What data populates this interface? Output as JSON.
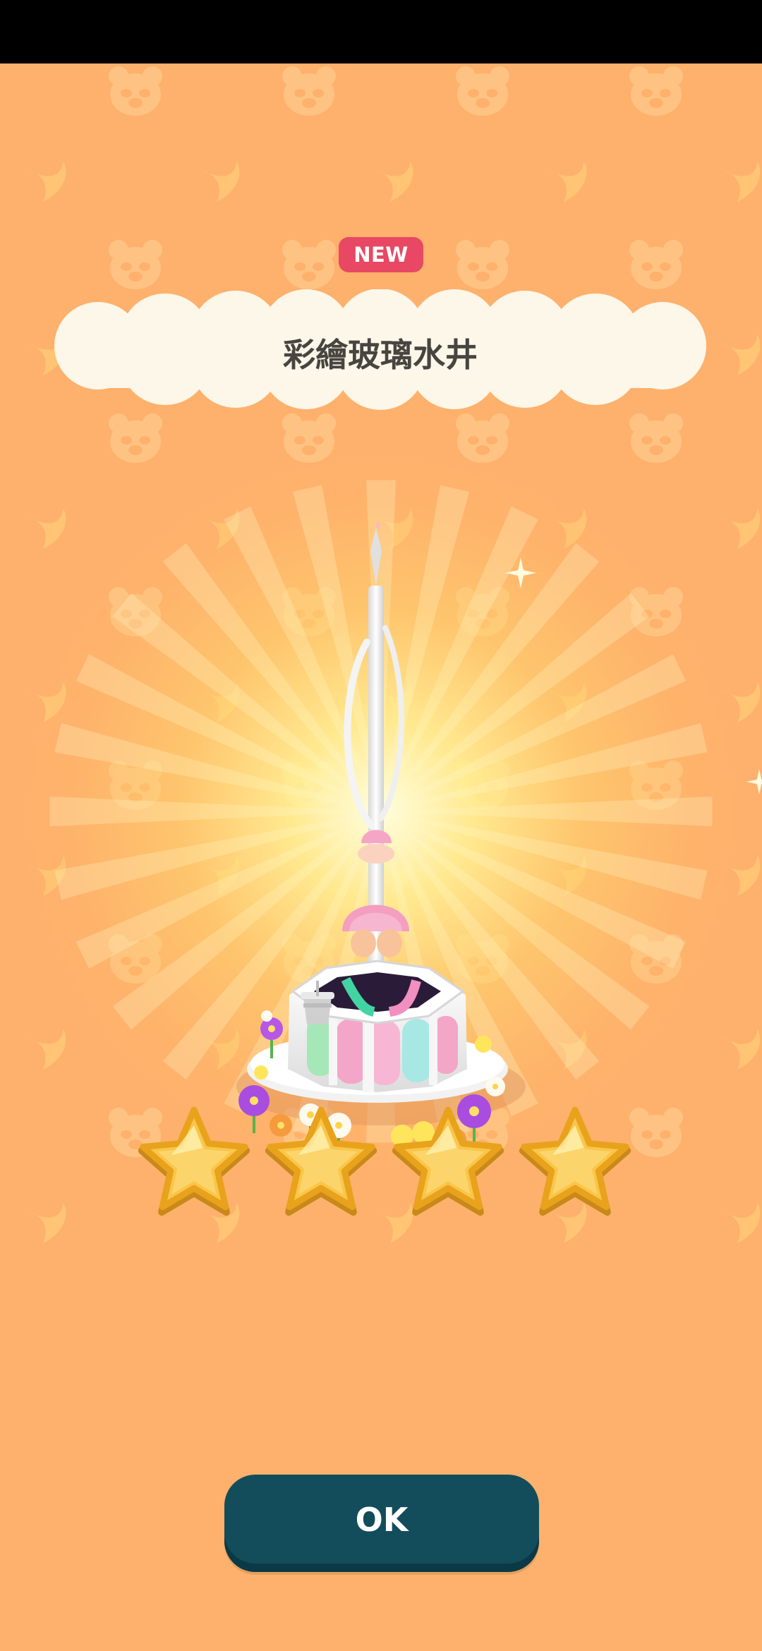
{
  "badge": {
    "label": "NEW"
  },
  "item": {
    "name": "彩繪玻璃水井"
  },
  "rating": {
    "stars": 4,
    "max": 4
  },
  "actions": {
    "ok_label": "OK"
  },
  "colors": {
    "background": "#feb16c",
    "badge": "#e84863",
    "name_cloud": "#fcf7e9",
    "button": "#134d5b",
    "star": "#f9c64a",
    "star_outline": "#e9a21c"
  },
  "icons": [
    "bear-face-icon",
    "moon-icon",
    "sparkle-icon",
    "star-icon"
  ]
}
